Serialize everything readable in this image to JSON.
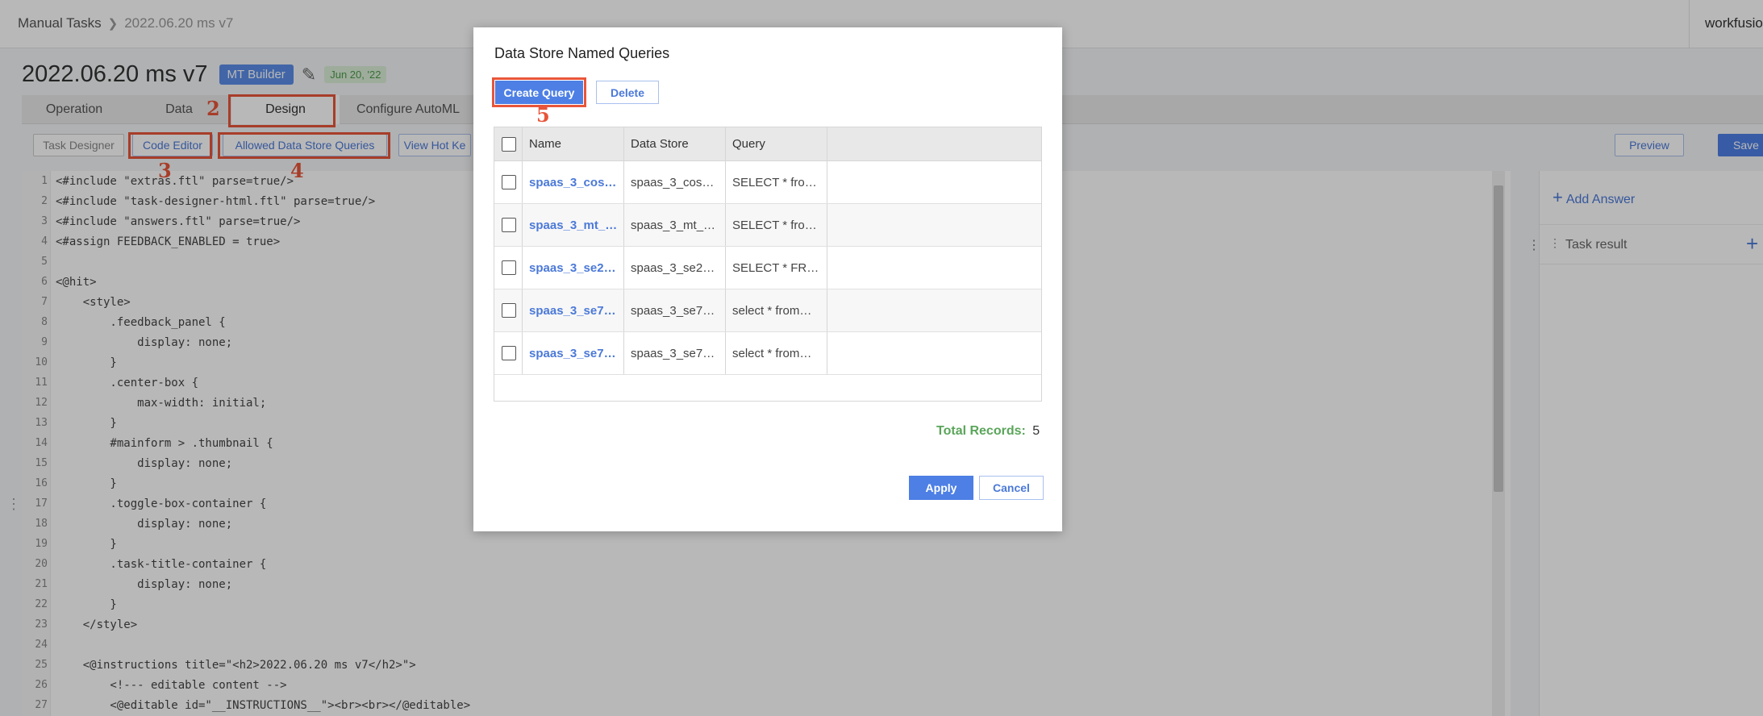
{
  "app": {
    "breadcrumb": [
      "Manual Tasks",
      "2022.06.20 ms v7"
    ],
    "brand": "workfusio",
    "title": "2022.06.20 ms v7",
    "mt_badge": "MT Builder",
    "date_badge": "Jun 20, '22"
  },
  "tabs": [
    {
      "label": "Operation"
    },
    {
      "label": "Data"
    },
    {
      "label": "Design"
    },
    {
      "label": "Configure AutoML"
    }
  ],
  "subtoolbar": {
    "task_designer": "Task Designer",
    "code_editor": "Code Editor",
    "allowed_queries": "Allowed Data Store Queries",
    "view_hot_keys": "View Hot Ke",
    "preview": "Preview",
    "save": "Save"
  },
  "code_lines": [
    "<#include \"extras.ftl\" parse=true/>",
    "<#include \"task-designer-html.ftl\" parse=true/>",
    "<#include \"answers.ftl\" parse=true/>",
    "<#assign FEEDBACK_ENABLED = true>",
    "",
    "<@hit>",
    "    <style>",
    "        .feedback_panel {",
    "            display: none;",
    "        }",
    "        .center-box {",
    "            max-width: initial;",
    "        }",
    "        #mainform > .thumbnail {",
    "            display: none;",
    "        }",
    "        .toggle-box-container {",
    "            display: none;",
    "        }",
    "        .task-title-container {",
    "            display: none;",
    "        }",
    "    </style>",
    "",
    "    <@instructions title=\"<h2>2022.06.20 ms v7</h2>\">",
    "        <!--- editable content -->",
    "        <@editable id=\"__INSTRUCTIONS__\"><br><br></@editable>"
  ],
  "right_panel": {
    "add_answer": "Add Answer",
    "task_result": "Task result"
  },
  "modal": {
    "title": "Data Store Named Queries",
    "create_label": "Create Query",
    "delete_label": "Delete",
    "columns": [
      "Name",
      "Data Store",
      "Query"
    ],
    "rows": [
      {
        "name": "spaas_3_cos…",
        "store": "spaas_3_cos…",
        "query": "SELECT * fro…"
      },
      {
        "name": "spaas_3_mt_…",
        "store": "spaas_3_mt_…",
        "query": "SELECT * fro…"
      },
      {
        "name": "spaas_3_se2…",
        "store": "spaas_3_se2…",
        "query": "SELECT * FR…"
      },
      {
        "name": "spaas_3_se7…",
        "store": "spaas_3_se7…",
        "query": "select * from…"
      },
      {
        "name": "spaas_3_se7…",
        "store": "spaas_3_se7…",
        "query": "select * from…"
      }
    ],
    "total_label": "Total Records:",
    "total_value": "5",
    "apply_label": "Apply",
    "cancel_label": "Cancel"
  },
  "annotations": [
    "2",
    "3",
    "4",
    "5"
  ],
  "colors": {
    "accent": "#4d7fe5",
    "highlight": "#e8553a",
    "success": "#5aa55a"
  }
}
